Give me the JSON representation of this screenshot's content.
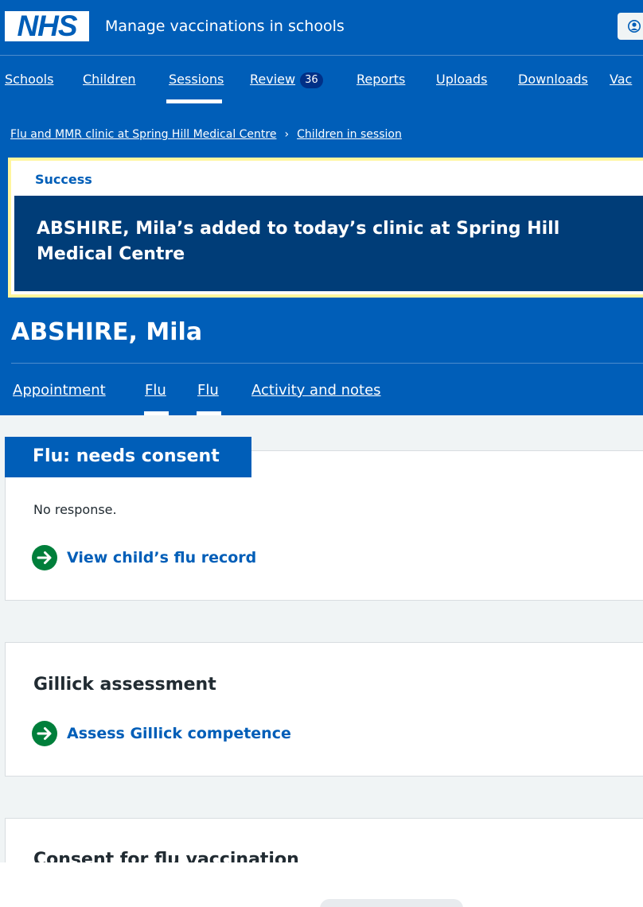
{
  "header": {
    "logo_text": "NHS",
    "service_name": "Manage vaccinations in schools",
    "account_icon": "user-circle-icon"
  },
  "nav": {
    "items": [
      {
        "label": "Schools"
      },
      {
        "label": "Children"
      },
      {
        "label": "Sessions",
        "current": true
      },
      {
        "label": "Review",
        "badge": "36"
      },
      {
        "label": "Reports"
      },
      {
        "label": "Uploads"
      },
      {
        "label": "Downloads"
      },
      {
        "label": "Vac"
      }
    ]
  },
  "breadcrumb": {
    "items": [
      "Flu and MMR clinic at Spring Hill Medical Centre",
      "Children in session"
    ],
    "separator": "›"
  },
  "banner": {
    "title": "Success",
    "heading": "ABSHIRE, Mila’s added to today’s clinic at Spring Hill Medical Centre"
  },
  "patient": {
    "name": "ABSHIRE, Mila"
  },
  "sub_nav": {
    "items": [
      {
        "label": "Appointment"
      },
      {
        "label": "Flu",
        "selected": true
      },
      {
        "label": "Flu",
        "selected": true
      },
      {
        "label": "Activity and notes"
      }
    ]
  },
  "cards": {
    "consent_status": {
      "tag": "Flu: needs consent",
      "text": "No response.",
      "link": "View child’s flu record"
    },
    "gillick": {
      "heading": "Gillick assessment",
      "link": "Assess Gillick competence"
    },
    "consent": {
      "heading": "Consent for flu vaccination"
    }
  },
  "colors": {
    "brand_blue": "#005eb8",
    "dark_blue": "#003d78",
    "link_green": "#007f3b",
    "banner_border": "#fff59d",
    "background": "#f0f4f5"
  }
}
